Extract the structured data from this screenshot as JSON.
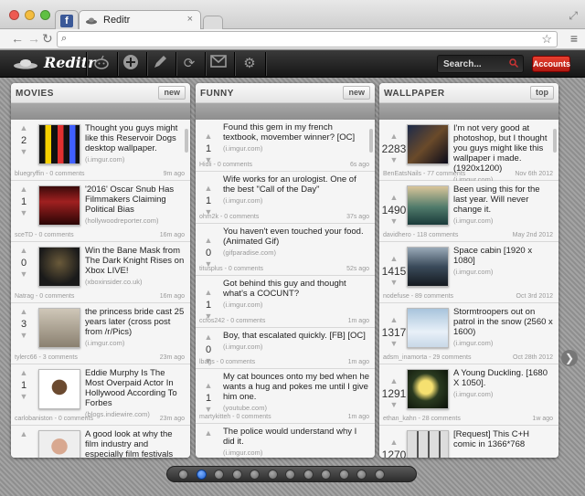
{
  "browser": {
    "tabs": [
      {
        "label": "",
        "icon": "facebook-icon"
      },
      {
        "label": "Reditr",
        "icon": "reditr-icon"
      },
      {
        "label": "",
        "icon": "new-tab-icon"
      }
    ],
    "url": "",
    "tab_close": "×"
  },
  "appbar": {
    "logo": "Reditr",
    "search_placeholder": "Search...",
    "accounts_label": "Accounts"
  },
  "columns": [
    {
      "title": "MOVIES",
      "sort": "new",
      "posts": [
        {
          "score": "2",
          "title": "Thought you guys might like this Reservoir Dogs desktop wallpaper.",
          "domain": "(i.imgur.com)",
          "user": "bluegryffin - 0 comments",
          "age": "9m ago"
        },
        {
          "score": "1",
          "title": "'2016' Oscar Snub Has Filmmakers Claiming Political Bias",
          "domain": "(hollywoodreporter.com)",
          "user": "sceTD - 0 comments",
          "age": "16m ago"
        },
        {
          "score": "0",
          "title": "Win the Bane Mask from The Dark Knight Rises on Xbox LIVE!",
          "domain": "(xboxinsider.co.uk)",
          "user": "Natrag - 0 comments",
          "age": "16m ago"
        },
        {
          "score": "3",
          "title": "the princess bride cast 25 years later (cross post from /r/Pics)",
          "domain": "(i.imgur.com)",
          "user": "tylerc66 - 3 comments",
          "age": "23m ago"
        },
        {
          "score": "1",
          "title": "Eddie Murphy Is The Most Overpaid Actor In Hollywood According To Forbes",
          "domain": "(blogs.indiewire.com)",
          "user": "carlobaniston - 0 comments",
          "age": "23m ago"
        },
        {
          "score": "",
          "title": "A good look at why the film industry and especially film festivals do everything but",
          "domain": "",
          "user": "",
          "age": ""
        }
      ]
    },
    {
      "title": "FUNNY",
      "sort": "new",
      "posts": [
        {
          "score": "1",
          "title": "Found this gem in my french textbook, movember winner? [OC]",
          "domain": "(i.imgur.com)",
          "user": "Hidli - 0 comments",
          "age": "6s ago"
        },
        {
          "score": "1",
          "title": "Wife works for an urologist. One of the best \"Call of the Day\"",
          "domain": "(i.imgur.com)",
          "user": "ohm2k - 0 comments",
          "age": "37s ago"
        },
        {
          "score": "0",
          "title": "You haven't even touched your food. (Animated Gif)",
          "domain": "(gifparadise.com)",
          "user": "titusplus - 0 comments",
          "age": "52s ago"
        },
        {
          "score": "1",
          "title": "Got behind this guy and thought what's a COCUNT?",
          "domain": "(i.imgur.com)",
          "user": "ccfos242 - 0 comments",
          "age": "1m ago"
        },
        {
          "score": "0",
          "title": "Boy, that escalated quickly. [FB] [OC]",
          "domain": "(i.imgur.com)",
          "user": "lbags - 0 comments",
          "age": "1m ago"
        },
        {
          "score": "1",
          "title": "My cat bounces onto my bed when he wants a hug and pokes me until I give him one.",
          "domain": "(youtube.com)",
          "user": "martykitteh - 0 comments",
          "age": "1m ago"
        },
        {
          "score": "",
          "title": "The police would understand why I did it.",
          "domain": "(i.imgur.com)",
          "user": "",
          "age": ""
        }
      ]
    },
    {
      "title": "WALLPAPER",
      "sort": "top",
      "posts": [
        {
          "score": "2283",
          "title": "I'm not very good at photoshop, but I thought you guys might like this wallpaper i made. (1920x1200)",
          "domain": "(i.imgur.com)",
          "user": "BenEatsNails - 77 comments",
          "age": "Nov 6th 2012"
        },
        {
          "score": "1490",
          "title": "Been using this for the last year. Will never change it.",
          "domain": "(i.imgur.com)",
          "user": "davidhero - 118 comments",
          "age": "May 2nd 2012"
        },
        {
          "score": "1415",
          "title": "Space cabin [1920 x 1080]",
          "domain": "(i.imgur.com)",
          "user": "nodefuse - 89 comments",
          "age": "Oct 3rd 2012"
        },
        {
          "score": "1317",
          "title": "Stormtroopers out on patrol in the snow (2560 x 1600)",
          "domain": "(i.imgur.com)",
          "user": "adsm_inamorta - 29 comments",
          "age": "Oct 28th 2012"
        },
        {
          "score": "1291",
          "title": "A Young Duckling. [1680 X 1050].",
          "domain": "(i.imgur.com)",
          "user": "ethan_kahn - 28 comments",
          "age": "1w ago"
        },
        {
          "score": "1270",
          "title": "[Request] This C+H comic in 1366*768",
          "domain": "",
          "user": "",
          "age": ""
        }
      ]
    }
  ],
  "pager": {
    "count": 12,
    "active": 1
  }
}
